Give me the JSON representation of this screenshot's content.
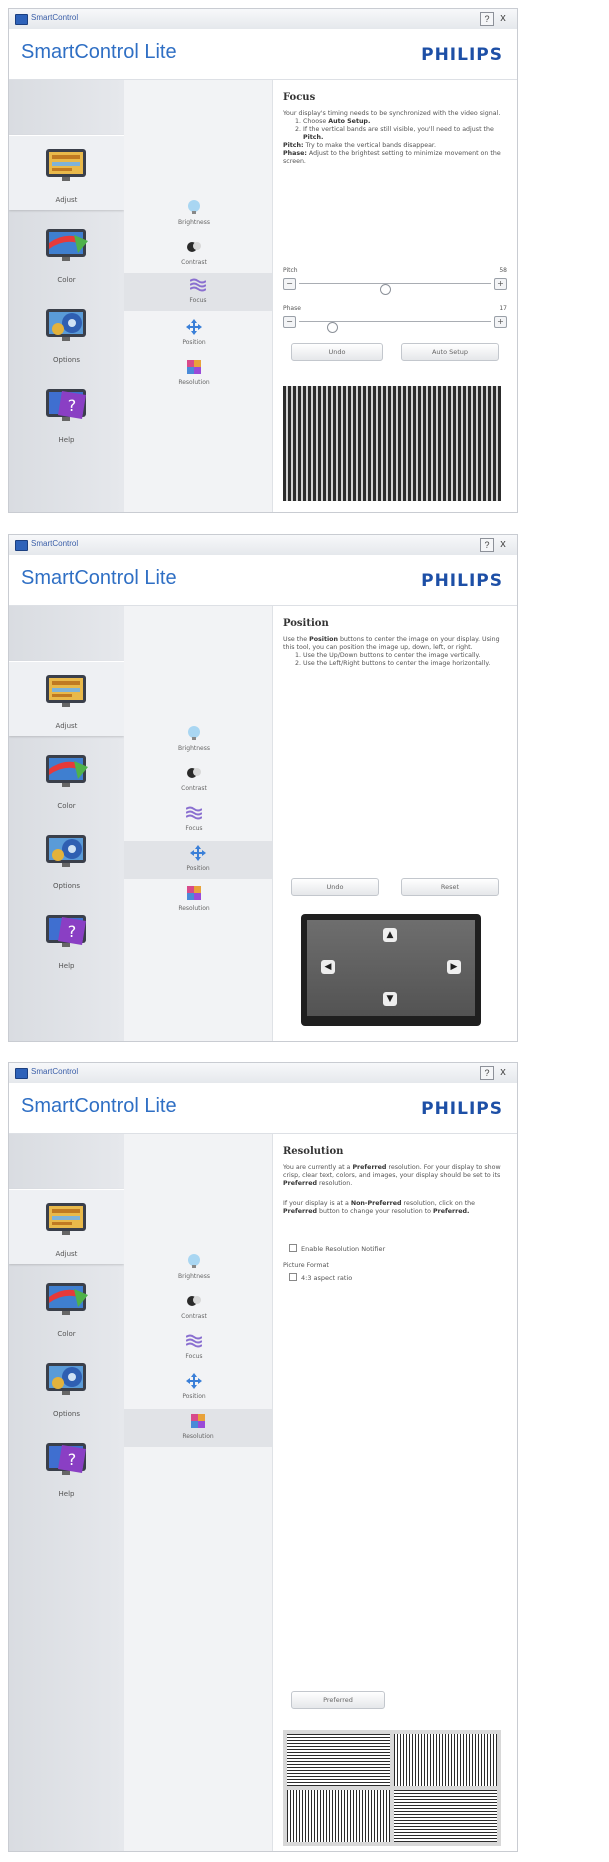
{
  "app": {
    "window_title": "SmartControl",
    "product": "SmartControl Lite",
    "brand": "PHILIPS",
    "help_glyph": "?",
    "close_glyph": "x"
  },
  "nav": {
    "adjust": "Adjust",
    "color": "Color",
    "options": "Options",
    "help": "Help"
  },
  "sub": {
    "brightness": "Brightness",
    "contrast": "Contrast",
    "focus": "Focus",
    "position": "Position",
    "resolution": "Resolution"
  },
  "focus": {
    "title": "Focus",
    "intro": "Your display's timing needs to be synchronized with the video signal.",
    "step1_pre": "Choose ",
    "step1_bold": "Auto Setup.",
    "step2_pre": "If the vertical bands are still visible, you'll need to adjust the ",
    "step2_bold": "Pitch.",
    "pitch_bold": "Pitch:",
    "pitch_text": " Try to make the vertical bands disappear.",
    "phase_bold": "Phase:",
    "phase_text": " Adjust to the brightest setting to minimize movement on the screen.",
    "pitch_label": "Pitch",
    "pitch_value": "58",
    "pitch_level": 0.45,
    "phase_label": "Phase",
    "phase_value": "17",
    "phase_level": 0.17,
    "minus": "−",
    "plus": "+",
    "undo": "Undo",
    "auto_setup": "Auto Setup"
  },
  "position": {
    "title": "Position",
    "intro_pre": "Use the ",
    "intro_bold": "Position",
    "intro_post": " buttons to center the image on your display. Using this tool, you can position the image up, down, left, or right.",
    "step1": "Use the Up/Down buttons to center the image vertically.",
    "step2": "Use the Left/Right buttons to center the image horizontally.",
    "undo": "Undo",
    "reset": "Reset",
    "up": "▲",
    "down": "▼",
    "left": "◀",
    "right": "▶"
  },
  "resolution": {
    "title": "Resolution",
    "p1_pre": "You are currently at a ",
    "p1_bold": "Preferred",
    "p1_mid": " resolution. For your display to show crisp, clear text, colors, and images, your display should be set to its ",
    "p1_bold2": "Preferred",
    "p1_post": " resolution.",
    "p2_pre": "If your display is at a ",
    "p2_bold": "Non-Preferred",
    "p2_mid": " resolution, click on the ",
    "p2_bold2": "Preferred",
    "p2_post": " button to change your resolution to ",
    "p2_bold3": "Preferred.",
    "enable_notifier": "Enable Resolution Notifier",
    "picture_format": "Picture Format",
    "aspect": "4:3 aspect ratio",
    "preferred_button": "Preferred"
  }
}
